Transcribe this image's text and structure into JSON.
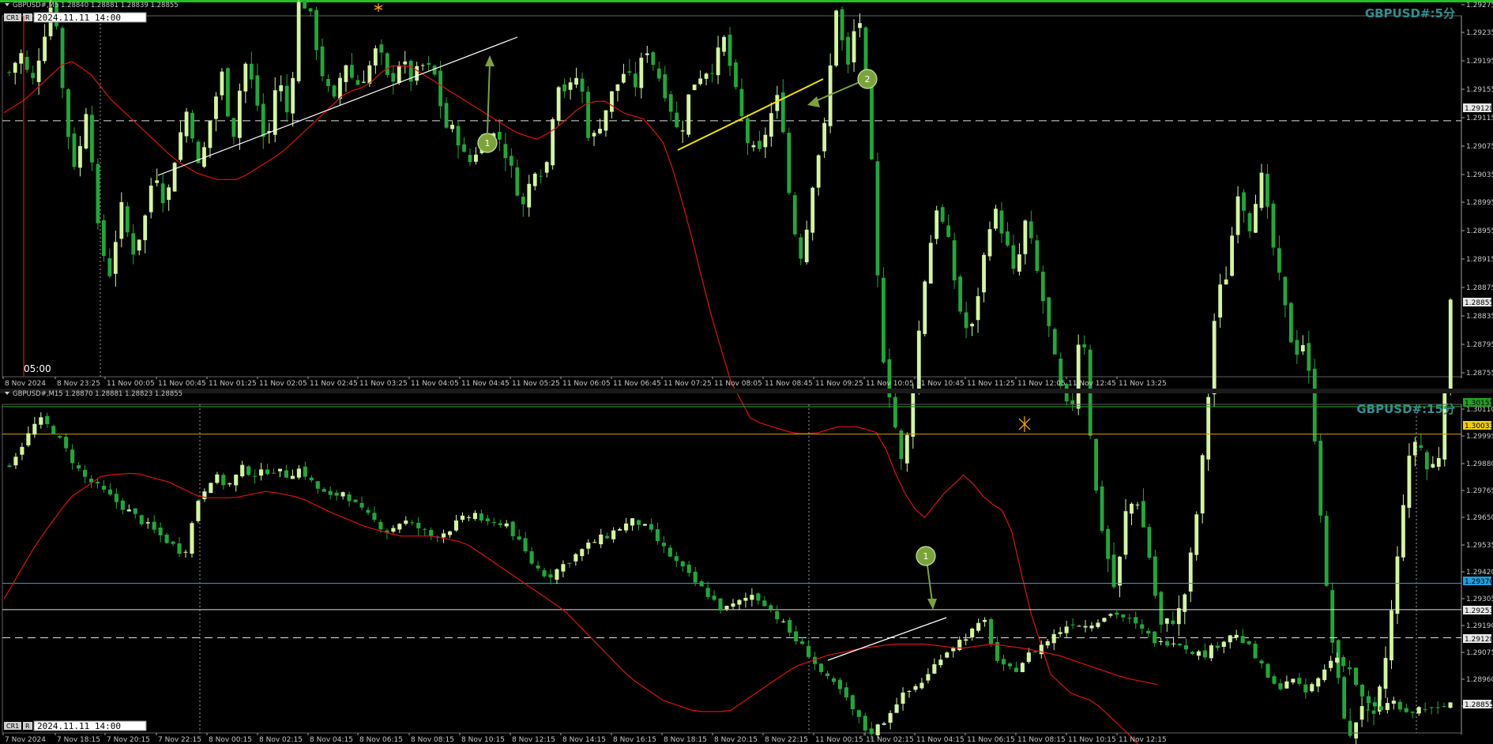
{
  "theme": {
    "bg": "#000000",
    "bull": "#d4f5a0",
    "bear": "#1fa83a",
    "ma": "#e01010",
    "grid": "#c0c0c0",
    "axis_text": "#c8c8c8",
    "title_color": "#2f8f8f",
    "marker_fill": "#7ba33a",
    "top_bar": "#22c022",
    "trend_yellow": "#f0e000"
  },
  "panels": [
    {
      "header": "GBPUSD#,M5  1.28840 1.28881 1.28839 1.28855",
      "title": "GBPUSD#:5分",
      "btn1": "CR1",
      "btn2": "R",
      "datetime": "2024.11.11 14:00",
      "cursor_time_label": "05:00",
      "price_labels": [
        "1.29275",
        "1.29235",
        "1.29195",
        "1.29155",
        "1.29115",
        "1.29075",
        "1.29035",
        "1.28995",
        "1.28955",
        "1.28915",
        "1.28875",
        "1.28835",
        "1.28795",
        "1.28755"
      ],
      "price_tags": [
        {
          "text": "1.29128",
          "kind": "white"
        },
        {
          "text": "1.28855",
          "kind": "white"
        }
      ],
      "time_labels": [
        "8 Nov 2024",
        "8 Nov 23:25",
        "11 Nov 00:05",
        "11 Nov 00:45",
        "11 Nov 01:25",
        "11 Nov 02:05",
        "11 Nov 02:45",
        "11 Nov 03:25",
        "11 Nov 04:05",
        "11 Nov 04:45",
        "11 Nov 05:25",
        "11 Nov 06:05",
        "11 Nov 06:45",
        "11 Nov 07:25",
        "11 Nov 08:05",
        "11 Nov 08:45",
        "11 Nov 09:25",
        "11 Nov 10:05",
        "11 Nov 10:45",
        "11 Nov 11:25",
        "11 Nov 12:05",
        "11 Nov 12:45",
        "11 Nov 13:25"
      ],
      "markers": [
        "1",
        "2"
      ]
    },
    {
      "header": "GBPUSD#,M15  1.28870 1.28881 1.28823 1.28855",
      "title": "GBPUSD#:15分",
      "btn1": "CR1",
      "btn2": "R",
      "datetime": "2024.11.11 14:00",
      "price_labels": [
        "1.30110",
        "1.29995",
        "1.29880",
        "1.29765",
        "1.29650",
        "1.29535",
        "1.29420",
        "1.29305",
        "1.29190",
        "1.29075",
        "1.28960",
        "1.28740"
      ],
      "price_tags": [
        {
          "text": "1.30155",
          "kind": "green"
        },
        {
          "text": "1.30033",
          "kind": "yellow"
        },
        {
          "text": "1.29370",
          "kind": "blue"
        },
        {
          "text": "1.29253",
          "kind": "white"
        },
        {
          "text": "1.29128",
          "kind": "white"
        },
        {
          "text": "1.28855",
          "kind": "white"
        }
      ],
      "time_labels": [
        "7 Nov 2024",
        "7 Nov 18:15",
        "7 Nov 20:15",
        "7 Nov 22:15",
        "8 Nov 00:15",
        "8 Nov 02:15",
        "8 Nov 04:15",
        "8 Nov 06:15",
        "8 Nov 08:15",
        "8 Nov 10:15",
        "8 Nov 12:15",
        "8 Nov 14:15",
        "8 Nov 16:15",
        "8 Nov 18:15",
        "8 Nov 20:15",
        "8 Nov 22:15",
        "11 Nov 00:15",
        "11 Nov 02:15",
        "11 Nov 04:15",
        "11 Nov 06:15",
        "11 Nov 08:15",
        "11 Nov 10:15",
        "11 Nov 12:15"
      ],
      "markers": [
        "1"
      ]
    }
  ],
  "chart_data": [
    {
      "type": "candlestick",
      "symbol": "GBPUSD#",
      "timeframe": "M5",
      "ylim": [
        1.28745,
        1.29285
      ],
      "close_trace": [
        1.292,
        1.2923,
        1.2918,
        1.2925,
        1.2932,
        1.2913,
        1.2905,
        1.2916,
        1.2895,
        1.289,
        1.29,
        1.2893,
        1.2897,
        1.2906,
        1.29,
        1.2909,
        1.2915,
        1.2905,
        1.2913,
        1.292,
        1.291,
        1.2922,
        1.2917,
        1.2908,
        1.292,
        1.2913,
        1.2932,
        1.2928,
        1.292,
        1.2915,
        1.2922,
        1.2918,
        1.292,
        1.2924,
        1.2918,
        1.2922,
        1.2919,
        1.2921,
        1.292,
        1.2912,
        1.2911,
        1.2906,
        1.2909,
        1.2911,
        1.291,
        1.2905,
        1.29,
        1.2906,
        1.2905,
        1.2919,
        1.2917,
        1.292,
        1.2909,
        1.2913,
        1.2917,
        1.292,
        1.2918,
        1.2924,
        1.292,
        1.2916,
        1.291,
        1.2918,
        1.292,
        1.2921,
        1.2925,
        1.2917,
        1.291,
        1.2907,
        1.2913,
        1.2917,
        1.2898,
        1.2892,
        1.2905,
        1.2912,
        1.293,
        1.292,
        1.293,
        1.2912,
        1.288,
        1.287,
        1.286,
        1.2875,
        1.289,
        1.29,
        1.2895,
        1.2885,
        1.288,
        1.289,
        1.29,
        1.2896,
        1.2889,
        1.2898,
        1.289,
        1.2882,
        1.2873,
        1.2868,
        1.2885,
        1.286,
        1.285,
        1.2842,
        1.2855,
        1.2856,
        1.2848,
        1.2837,
        1.2838,
        1.284,
        1.285,
        1.2865,
        1.2886,
        1.289,
        1.2903,
        1.2897,
        1.2905,
        1.2895,
        1.2886,
        1.2878,
        1.288,
        1.2863,
        1.284,
        1.2828,
        1.282,
        1.2826,
        1.2822,
        1.283,
        1.2843,
        1.286,
        1.2866,
        1.286,
        1.2863,
        1.2885
      ],
      "ma_trace": [
        1.2914,
        1.2916,
        1.2919,
        1.2922,
        1.292,
        1.2916,
        1.2913,
        1.291,
        1.2907,
        1.2905,
        1.2904,
        1.2904,
        1.2906,
        1.2908,
        1.2911,
        1.2914,
        1.2917,
        1.2918,
        1.2921,
        1.2921,
        1.2919,
        1.2917,
        1.2915,
        1.2913,
        1.2911,
        1.291,
        1.2912,
        1.2915,
        1.2916,
        1.2914,
        1.2913,
        1.2909,
        1.2898,
        1.2885,
        1.2874,
        1.2868,
        1.2867,
        1.2866,
        1.2866,
        1.2867,
        1.2867,
        1.2866,
        1.2858,
        1.2853,
        1.2857,
        1.286,
        1.2856,
        1.2854,
        1.284,
        1.283,
        1.2827,
        1.2826,
        1.2823,
        1.282,
        1.2815
      ],
      "horizontal_levels": [
        1.29128
      ],
      "trendlines": [
        "white uptrend 8 Nov 23:25–11 Nov 04:45",
        "white uptrend 11 Nov 04:45–11 Nov 05:25",
        "yellow uptrend 11 Nov 07:25–11 Nov 08:45"
      ]
    },
    {
      "type": "candlestick",
      "symbol": "GBPUSD#",
      "timeframe": "M15",
      "ylim": [
        1.28705,
        1.30165
      ],
      "close_trace": [
        1.299,
        1.3,
        1.301,
        1.3005,
        1.2995,
        1.2985,
        1.298,
        1.2975,
        1.297,
        1.2965,
        1.296,
        1.2955,
        1.295,
        1.2975,
        1.2985,
        1.298,
        1.2988,
        1.2985,
        1.2988,
        1.2985,
        1.2988,
        1.298,
        1.2975,
        1.2978,
        1.297,
        1.2965,
        1.296,
        1.2965,
        1.2962,
        1.2958,
        1.296,
        1.2965,
        1.2968,
        1.2962,
        1.2965,
        1.2955,
        1.2945,
        1.294,
        1.2945,
        1.295,
        1.2955,
        1.2958,
        1.2962,
        1.2965,
        1.296,
        1.2952,
        1.2945,
        1.2938,
        1.2932,
        1.2925,
        1.2928,
        1.2932,
        1.2928,
        1.292,
        1.2912,
        1.2905,
        1.2895,
        1.289,
        1.288,
        1.287,
        1.2875,
        1.2885,
        1.289,
        1.2895,
        1.2905,
        1.291,
        1.2915,
        1.292,
        1.29,
        1.2898,
        1.2905,
        1.291,
        1.2915,
        1.292,
        1.2918,
        1.2922,
        1.2924,
        1.292,
        1.2915,
        1.291,
        1.2912,
        1.2908,
        1.2905,
        1.291,
        1.2915,
        1.291,
        1.29,
        1.289,
        1.2895,
        1.2888,
        1.2895,
        1.2905,
        1.29,
        1.2885,
        1.288,
        1.2885,
        1.2878,
        1.2882,
        1.288,
        1.2884
      ],
      "ma_trace": [
        1.293,
        1.2955,
        1.2975,
        1.2985,
        1.2986,
        1.2982,
        1.2975,
        1.2975,
        1.2978,
        1.2975,
        1.2968,
        1.2962,
        1.2958,
        1.2958,
        1.2955,
        1.2945,
        1.2935,
        1.2925,
        1.291,
        1.2895,
        1.2885,
        1.288,
        1.288,
        1.289,
        1.29,
        1.2905,
        1.2908,
        1.291,
        1.291,
        1.2908,
        1.291,
        1.2908,
        1.2905,
        1.29,
        1.2895,
        1.2892
      ],
      "horizontal_levels": [
        1.30155,
        1.30033,
        1.2937,
        1.29253,
        1.29128
      ],
      "trendlines": [
        "white uptrend 11 Nov 00:15–11 Nov 04:15"
      ]
    }
  ]
}
